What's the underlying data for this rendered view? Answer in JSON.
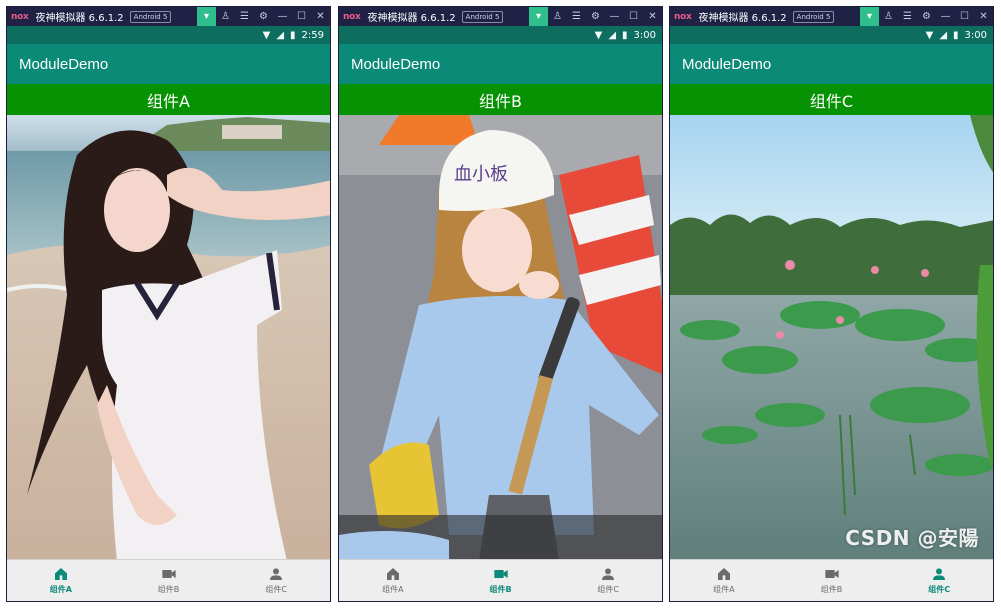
{
  "windows": [
    {
      "title": "夜神模拟器 6.6.1.2",
      "android_badge": "Android 5",
      "time": "2:59",
      "app_title": "ModuleDemo",
      "component_label": "组件A",
      "nav": [
        {
          "label": "组件A",
          "icon": "home-icon",
          "active": true
        },
        {
          "label": "组件B",
          "icon": "video-icon",
          "active": false
        },
        {
          "label": "组件C",
          "icon": "person-icon",
          "active": false
        }
      ]
    },
    {
      "title": "夜神模拟器 6.6.1.2",
      "android_badge": "Android 5",
      "time": "3:00",
      "app_title": "ModuleDemo",
      "component_label": "组件B",
      "nav": [
        {
          "label": "组件A",
          "icon": "home-icon",
          "active": false
        },
        {
          "label": "组件B",
          "icon": "video-icon",
          "active": true
        },
        {
          "label": "组件C",
          "icon": "person-icon",
          "active": false
        }
      ]
    },
    {
      "title": "夜神模拟器 6.6.1.2",
      "android_badge": "Android 5",
      "time": "3:00",
      "app_title": "ModuleDemo",
      "component_label": "组件C",
      "nav": [
        {
          "label": "组件A",
          "icon": "home-icon",
          "active": false
        },
        {
          "label": "组件B",
          "icon": "video-icon",
          "active": false
        },
        {
          "label": "组件C",
          "icon": "person-icon",
          "active": true
        }
      ]
    }
  ],
  "nox_logo": "nox",
  "cap_text": "血小板",
  "watermark": "CSDN @安陽",
  "colors": {
    "titlebar": "#1f2245",
    "statusbar": "#0d6e60",
    "appbar": "#0c8a78",
    "component_bar": "#079203",
    "active_nav": "#0c8a78"
  }
}
